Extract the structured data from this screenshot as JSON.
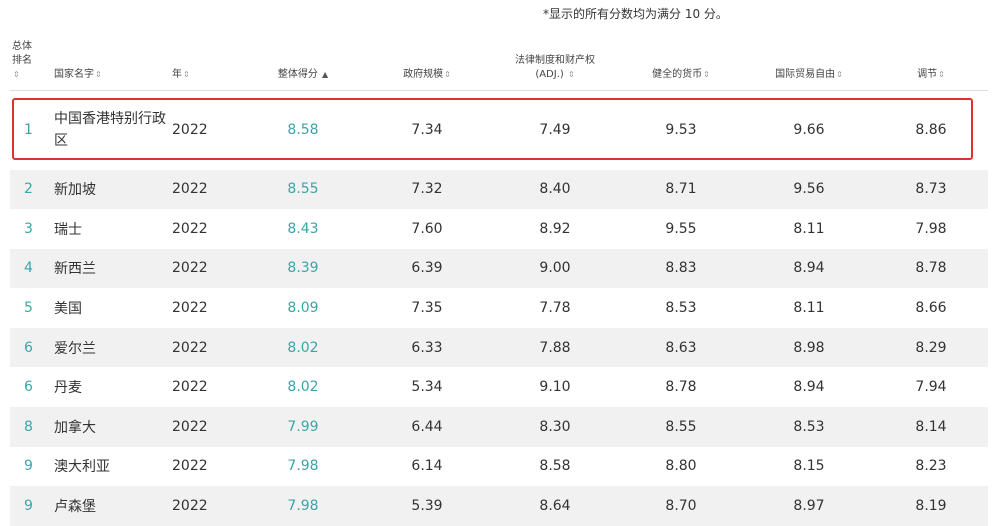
{
  "note": "*显示的所有分数均为满分 10 分。",
  "columns": {
    "rank": [
      "总体",
      "排名"
    ],
    "name": "国家名字",
    "year": "年",
    "overall": "整体得分",
    "gov_size": "政府规模",
    "law_line1": "法律制度和财产权",
    "law_line2": "(ADJ.)",
    "money": "健全的货币",
    "trade": "国际贸易自由",
    "regulation": "调节"
  },
  "sort_icons": {
    "neutral": "⇕",
    "ascending": "▲"
  },
  "rows": [
    {
      "rank": "1",
      "name": "中国香港特别行政区",
      "year": "2022",
      "overall": "8.58",
      "gov": "7.34",
      "law": "7.49",
      "money": "9.53",
      "trade": "9.66",
      "reg": "8.86"
    },
    {
      "rank": "2",
      "name": "新加坡",
      "year": "2022",
      "overall": "8.55",
      "gov": "7.32",
      "law": "8.40",
      "money": "8.71",
      "trade": "9.56",
      "reg": "8.73"
    },
    {
      "rank": "3",
      "name": "瑞士",
      "year": "2022",
      "overall": "8.43",
      "gov": "7.60",
      "law": "8.92",
      "money": "9.55",
      "trade": "8.11",
      "reg": "7.98"
    },
    {
      "rank": "4",
      "name": "新西兰",
      "year": "2022",
      "overall": "8.39",
      "gov": "6.39",
      "law": "9.00",
      "money": "8.83",
      "trade": "8.94",
      "reg": "8.78"
    },
    {
      "rank": "5",
      "name": "美国",
      "year": "2022",
      "overall": "8.09",
      "gov": "7.35",
      "law": "7.78",
      "money": "8.53",
      "trade": "8.11",
      "reg": "8.66"
    },
    {
      "rank": "6",
      "name": "爱尔兰",
      "year": "2022",
      "overall": "8.02",
      "gov": "6.33",
      "law": "7.88",
      "money": "8.63",
      "trade": "8.98",
      "reg": "8.29"
    },
    {
      "rank": "6",
      "name": "丹麦",
      "year": "2022",
      "overall": "8.02",
      "gov": "5.34",
      "law": "9.10",
      "money": "8.78",
      "trade": "8.94",
      "reg": "7.94"
    },
    {
      "rank": "8",
      "name": "加拿大",
      "year": "2022",
      "overall": "7.99",
      "gov": "6.44",
      "law": "8.30",
      "money": "8.55",
      "trade": "8.53",
      "reg": "8.14"
    },
    {
      "rank": "9",
      "name": "澳大利亚",
      "year": "2022",
      "overall": "7.98",
      "gov": "6.14",
      "law": "8.58",
      "money": "8.80",
      "trade": "8.15",
      "reg": "8.23"
    },
    {
      "rank": "9",
      "name": "卢森堡",
      "year": "2022",
      "overall": "7.98",
      "gov": "5.39",
      "law": "8.64",
      "money": "8.70",
      "trade": "8.97",
      "reg": "8.19"
    }
  ],
  "colors": {
    "accent": "#3aa5a8",
    "highlight": "#e03131",
    "zebra": "#f1f1f1"
  }
}
